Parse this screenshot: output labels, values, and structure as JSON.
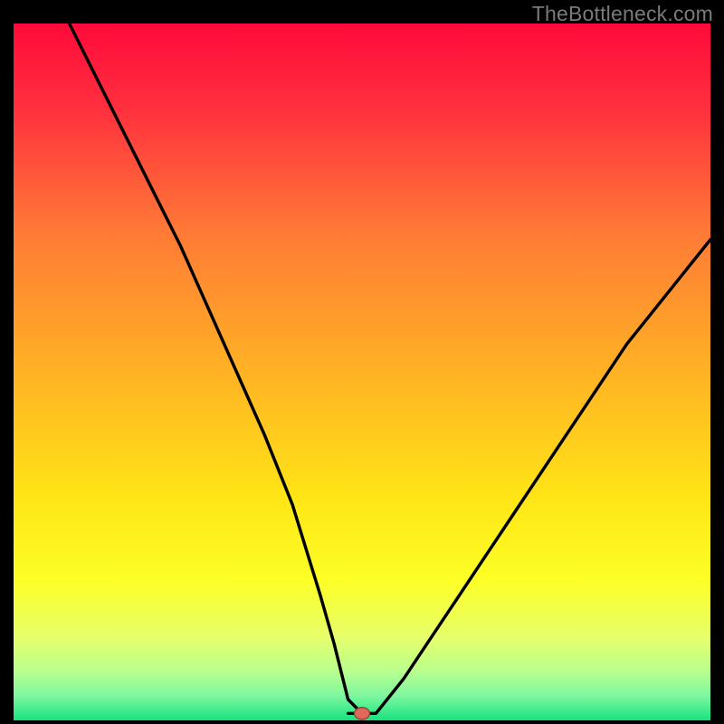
{
  "watermark": "TheBottleneck.com",
  "chart_data": {
    "type": "line",
    "title": "",
    "xlabel": "",
    "ylabel": "",
    "xlim": [
      0,
      100
    ],
    "ylim": [
      0,
      100
    ],
    "grid": false,
    "legend": false,
    "background": "gradient red-yellow-green (top-bottom)",
    "optimum_marker": {
      "x": 50,
      "y": 1,
      "color": "#e06a5a"
    },
    "series": [
      {
        "name": "left-branch",
        "x": [
          8,
          12,
          16,
          20,
          24,
          28,
          32,
          36,
          40,
          44,
          46,
          48,
          50
        ],
        "y": [
          100,
          92,
          84,
          76,
          68,
          59,
          50,
          41,
          31,
          18,
          11,
          3,
          1
        ]
      },
      {
        "name": "floor",
        "x": [
          48,
          52
        ],
        "y": [
          1,
          1
        ]
      },
      {
        "name": "right-branch",
        "x": [
          52,
          56,
          60,
          64,
          68,
          72,
          76,
          80,
          84,
          88,
          92,
          96,
          100
        ],
        "y": [
          1,
          6,
          12,
          18,
          24,
          30,
          36,
          42,
          48,
          54,
          59,
          64,
          69
        ]
      }
    ]
  }
}
